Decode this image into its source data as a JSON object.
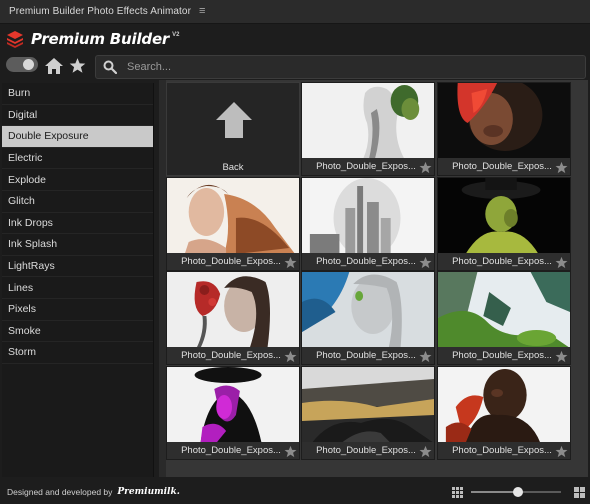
{
  "window": {
    "title": "Premium Builder Photo Effects Animator"
  },
  "brand": {
    "name": "Premium Builder",
    "version": "V2"
  },
  "toolbar": {
    "search_placeholder": "Search..."
  },
  "categories": [
    "Burn",
    "Digital",
    "Double Exposure",
    "Electric",
    "Explode",
    "Glitch",
    "Ink Drops",
    "Ink Splash",
    "LightRays",
    "Lines",
    "Pixels",
    "Smoke",
    "Storm"
  ],
  "active_category": "Double Exposure",
  "grid": {
    "back_label": "Back",
    "items": [
      {
        "label": "Photo_Double_Expos..."
      },
      {
        "label": "Photo_Double_Expos..."
      },
      {
        "label": "Photo_Double_Expos..."
      },
      {
        "label": "Photo_Double_Expos..."
      },
      {
        "label": "Photo_Double_Expos..."
      },
      {
        "label": "Photo_Double_Expos..."
      },
      {
        "label": "Photo_Double_Expos..."
      },
      {
        "label": "Photo_Double_Expos..."
      },
      {
        "label": "Photo_Double_Expos..."
      },
      {
        "label": "Photo_Double_Expos..."
      },
      {
        "label": "Photo_Double_Expos..."
      }
    ]
  },
  "footer": {
    "credit": "Designed and developed by",
    "maker": "Premiumilk."
  },
  "thumbnail_size": {
    "value": 0.52
  },
  "colors": {
    "accent_red": "#e4372c",
    "selected_bg": "#c9c9c9"
  }
}
